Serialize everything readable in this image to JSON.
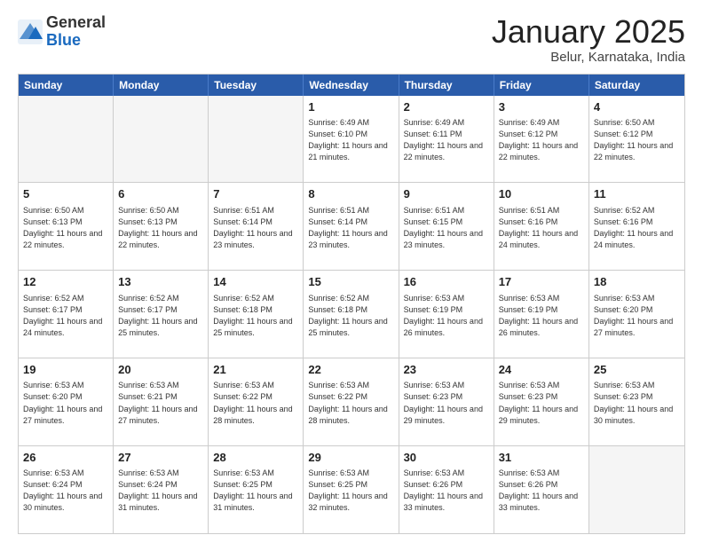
{
  "logo": {
    "general": "General",
    "blue": "Blue"
  },
  "title": "January 2025",
  "location": "Belur, Karnataka, India",
  "days_of_week": [
    "Sunday",
    "Monday",
    "Tuesday",
    "Wednesday",
    "Thursday",
    "Friday",
    "Saturday"
  ],
  "weeks": [
    [
      {
        "day": "",
        "info": ""
      },
      {
        "day": "",
        "info": ""
      },
      {
        "day": "",
        "info": ""
      },
      {
        "day": "1",
        "info": "Sunrise: 6:49 AM\nSunset: 6:10 PM\nDaylight: 11 hours and 21 minutes."
      },
      {
        "day": "2",
        "info": "Sunrise: 6:49 AM\nSunset: 6:11 PM\nDaylight: 11 hours and 22 minutes."
      },
      {
        "day": "3",
        "info": "Sunrise: 6:49 AM\nSunset: 6:12 PM\nDaylight: 11 hours and 22 minutes."
      },
      {
        "day": "4",
        "info": "Sunrise: 6:50 AM\nSunset: 6:12 PM\nDaylight: 11 hours and 22 minutes."
      }
    ],
    [
      {
        "day": "5",
        "info": "Sunrise: 6:50 AM\nSunset: 6:13 PM\nDaylight: 11 hours and 22 minutes."
      },
      {
        "day": "6",
        "info": "Sunrise: 6:50 AM\nSunset: 6:13 PM\nDaylight: 11 hours and 22 minutes."
      },
      {
        "day": "7",
        "info": "Sunrise: 6:51 AM\nSunset: 6:14 PM\nDaylight: 11 hours and 23 minutes."
      },
      {
        "day": "8",
        "info": "Sunrise: 6:51 AM\nSunset: 6:14 PM\nDaylight: 11 hours and 23 minutes."
      },
      {
        "day": "9",
        "info": "Sunrise: 6:51 AM\nSunset: 6:15 PM\nDaylight: 11 hours and 23 minutes."
      },
      {
        "day": "10",
        "info": "Sunrise: 6:51 AM\nSunset: 6:16 PM\nDaylight: 11 hours and 24 minutes."
      },
      {
        "day": "11",
        "info": "Sunrise: 6:52 AM\nSunset: 6:16 PM\nDaylight: 11 hours and 24 minutes."
      }
    ],
    [
      {
        "day": "12",
        "info": "Sunrise: 6:52 AM\nSunset: 6:17 PM\nDaylight: 11 hours and 24 minutes."
      },
      {
        "day": "13",
        "info": "Sunrise: 6:52 AM\nSunset: 6:17 PM\nDaylight: 11 hours and 25 minutes."
      },
      {
        "day": "14",
        "info": "Sunrise: 6:52 AM\nSunset: 6:18 PM\nDaylight: 11 hours and 25 minutes."
      },
      {
        "day": "15",
        "info": "Sunrise: 6:52 AM\nSunset: 6:18 PM\nDaylight: 11 hours and 25 minutes."
      },
      {
        "day": "16",
        "info": "Sunrise: 6:53 AM\nSunset: 6:19 PM\nDaylight: 11 hours and 26 minutes."
      },
      {
        "day": "17",
        "info": "Sunrise: 6:53 AM\nSunset: 6:19 PM\nDaylight: 11 hours and 26 minutes."
      },
      {
        "day": "18",
        "info": "Sunrise: 6:53 AM\nSunset: 6:20 PM\nDaylight: 11 hours and 27 minutes."
      }
    ],
    [
      {
        "day": "19",
        "info": "Sunrise: 6:53 AM\nSunset: 6:20 PM\nDaylight: 11 hours and 27 minutes."
      },
      {
        "day": "20",
        "info": "Sunrise: 6:53 AM\nSunset: 6:21 PM\nDaylight: 11 hours and 27 minutes."
      },
      {
        "day": "21",
        "info": "Sunrise: 6:53 AM\nSunset: 6:22 PM\nDaylight: 11 hours and 28 minutes."
      },
      {
        "day": "22",
        "info": "Sunrise: 6:53 AM\nSunset: 6:22 PM\nDaylight: 11 hours and 28 minutes."
      },
      {
        "day": "23",
        "info": "Sunrise: 6:53 AM\nSunset: 6:23 PM\nDaylight: 11 hours and 29 minutes."
      },
      {
        "day": "24",
        "info": "Sunrise: 6:53 AM\nSunset: 6:23 PM\nDaylight: 11 hours and 29 minutes."
      },
      {
        "day": "25",
        "info": "Sunrise: 6:53 AM\nSunset: 6:23 PM\nDaylight: 11 hours and 30 minutes."
      }
    ],
    [
      {
        "day": "26",
        "info": "Sunrise: 6:53 AM\nSunset: 6:24 PM\nDaylight: 11 hours and 30 minutes."
      },
      {
        "day": "27",
        "info": "Sunrise: 6:53 AM\nSunset: 6:24 PM\nDaylight: 11 hours and 31 minutes."
      },
      {
        "day": "28",
        "info": "Sunrise: 6:53 AM\nSunset: 6:25 PM\nDaylight: 11 hours and 31 minutes."
      },
      {
        "day": "29",
        "info": "Sunrise: 6:53 AM\nSunset: 6:25 PM\nDaylight: 11 hours and 32 minutes."
      },
      {
        "day": "30",
        "info": "Sunrise: 6:53 AM\nSunset: 6:26 PM\nDaylight: 11 hours and 33 minutes."
      },
      {
        "day": "31",
        "info": "Sunrise: 6:53 AM\nSunset: 6:26 PM\nDaylight: 11 hours and 33 minutes."
      },
      {
        "day": "",
        "info": ""
      }
    ]
  ]
}
